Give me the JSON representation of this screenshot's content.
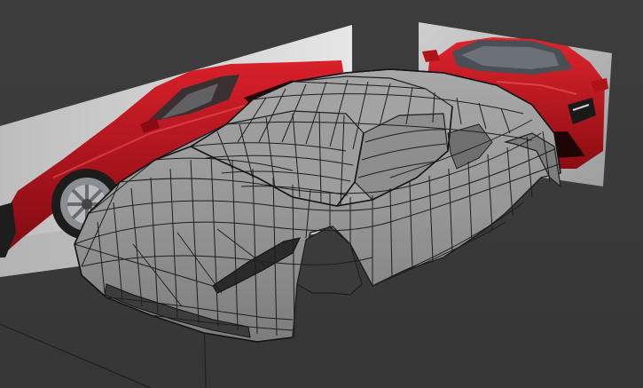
{
  "viewport": {
    "background_color": "#3b3b3b",
    "grid_line_color": "#1b1b1b",
    "mesh_fill_color": "#9a9a9a",
    "mesh_wire_color": "#1e1e1e",
    "reference_car_color": "#c0141e",
    "reference_backdrop_color": "#dcdcdc"
  },
  "objects": [
    {
      "name": "side-reference-plane",
      "kind": "reference-image",
      "view": "side"
    },
    {
      "name": "front-reference-plane",
      "kind": "reference-image",
      "view": "front"
    },
    {
      "name": "car-body-mesh",
      "kind": "polygon-mesh",
      "display": "wireframe-on-shaded"
    }
  ]
}
